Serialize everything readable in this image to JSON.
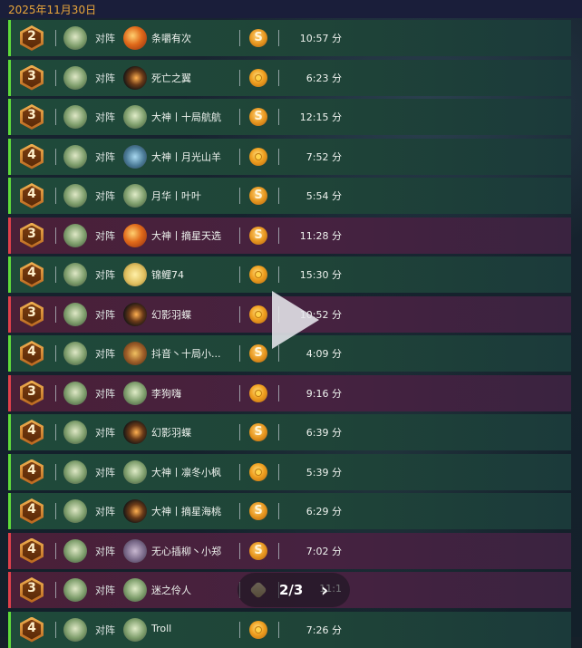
{
  "header": {
    "date": "2025年11月30日"
  },
  "vs_label": "对阵",
  "colors": {
    "win": "#5fdc3a",
    "loss": "#e0404a",
    "accent": "#e9a63a"
  },
  "matches": [
    {
      "rank": "2",
      "opponent": "条嚼有次",
      "time": "10:57 分",
      "result": "win",
      "opp_icon": "fire-hero-icon",
      "currency": "swirl"
    },
    {
      "rank": "3",
      "opponent": "死亡之翼",
      "time": "6:23 分",
      "result": "win",
      "opp_icon": "blade-hero-icon",
      "currency": "gold"
    },
    {
      "rank": "3",
      "opponent": "大神丨十局航航",
      "time": "12:15 分",
      "result": "win",
      "opp_icon": "knight-hero-icon",
      "currency": "swirl"
    },
    {
      "rank": "4",
      "opponent": "大神丨月光山羊",
      "time": "7:52 分",
      "result": "win",
      "opp_icon": "tech-hero-icon",
      "currency": "gold"
    },
    {
      "rank": "4",
      "opponent": "月华丨叶叶",
      "time": "5:54 分",
      "result": "win",
      "opp_icon": "knight-hero-icon",
      "currency": "swirl"
    },
    {
      "rank": "3",
      "opponent": "大神丨摘星天选",
      "time": "11:28 分",
      "result": "loss",
      "opp_icon": "fire-hero-icon",
      "currency": "swirl"
    },
    {
      "rank": "4",
      "opponent": "锦鲤74",
      "time": "15:30 分",
      "result": "win",
      "opp_icon": "mage-hero-icon",
      "currency": "gold"
    },
    {
      "rank": "3",
      "opponent": "幻影羽蝶",
      "time": "10:52 分",
      "result": "loss",
      "opp_icon": "blade-hero-icon",
      "currency": "gold"
    },
    {
      "rank": "4",
      "opponent": "抖音丶十局小...",
      "time": "4:09 分",
      "result": "win",
      "opp_icon": "tribal-hero-icon",
      "currency": "swirl"
    },
    {
      "rank": "3",
      "opponent": "李狗嗨",
      "time": "9:16 分",
      "result": "loss",
      "opp_icon": "knight-hero-icon",
      "currency": "gold"
    },
    {
      "rank": "4",
      "opponent": "幻影羽蝶",
      "time": "6:39 分",
      "result": "win",
      "opp_icon": "blade-hero-icon",
      "currency": "swirl"
    },
    {
      "rank": "4",
      "opponent": "大神丨凛冬小枫",
      "time": "5:39 分",
      "result": "win",
      "opp_icon": "knight-hero-icon",
      "currency": "gold"
    },
    {
      "rank": "4",
      "opponent": "大神丨摘星海桃",
      "time": "6:29 分",
      "result": "win",
      "opp_icon": "blade-hero-icon",
      "currency": "swirl"
    },
    {
      "rank": "4",
      "opponent": "无心插柳丶小郑",
      "time": "7:02 分",
      "result": "loss",
      "opp_icon": "rogue-hero-icon",
      "currency": "swirl"
    },
    {
      "rank": "3",
      "opponent": "迷之伶人",
      "time": "11:1",
      "result": "loss",
      "opp_icon": "knight-hero-icon",
      "currency": "gem"
    },
    {
      "rank": "4",
      "opponent": "Troll",
      "time": "7:26 分",
      "result": "win",
      "opp_icon": "knight-hero-icon",
      "currency": "gold"
    }
  ],
  "pager": {
    "text": "2/3",
    "next_icon": "chevron-right-icon"
  },
  "overlay": {
    "icon": "play-icon"
  }
}
